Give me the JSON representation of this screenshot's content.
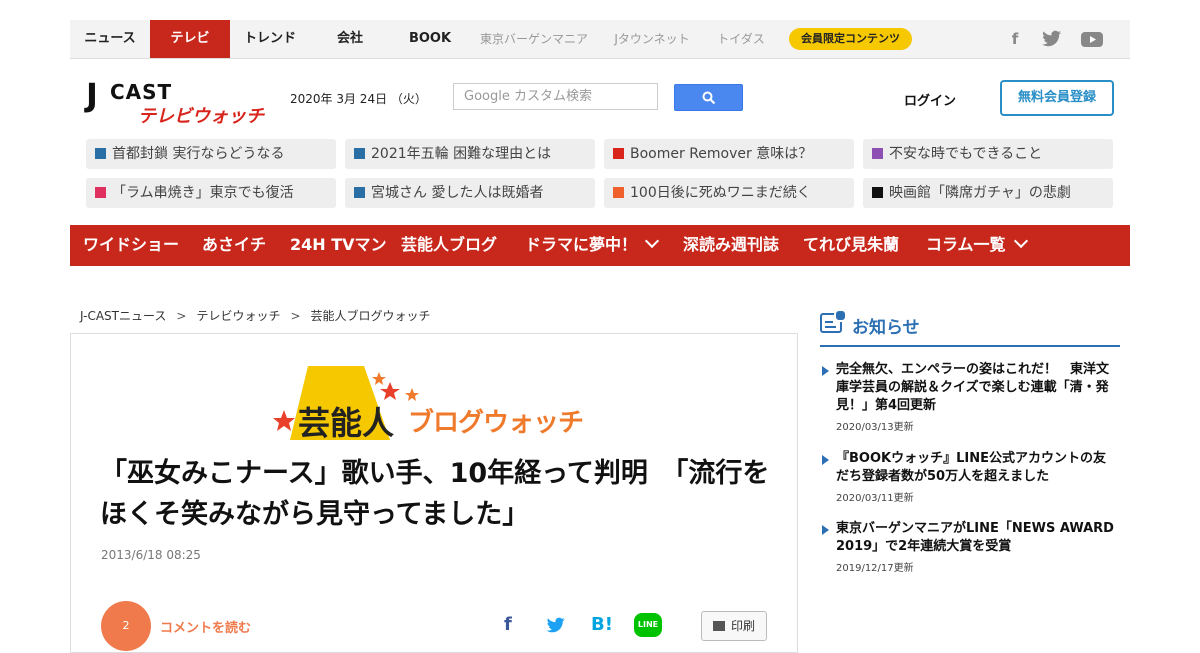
{
  "topnav": {
    "items": [
      "ニュース",
      "テレビ",
      "トレンド",
      "会社",
      "BOOK",
      "東京バーゲンマニア",
      "Jタウンネット",
      "トイダス"
    ],
    "members_badge": "会員限定コンテンツ",
    "social": [
      {
        "icon": "facebook-icon",
        "glyph": "f"
      },
      {
        "icon": "twitter-icon",
        "glyph": "🐦"
      },
      {
        "icon": "youtube-icon",
        "glyph": "▶"
      }
    ]
  },
  "header": {
    "logo_j": "J",
    "logo_cast": "CAST",
    "logo_sub": "テレビウォッチ",
    "date": "2020年 3月 24日 （火）",
    "search_placeholder": "Google カスタム検索",
    "login": "ログイン",
    "signup": "無料会員登録"
  },
  "trending": [
    {
      "text": "首都封鎖 実行ならどうなる",
      "color": "#2a6ea6"
    },
    {
      "text": "2021年五輪 困難な理由とは",
      "color": "#2a6ea6"
    },
    {
      "text": "Boomer Remover 意味は？",
      "color": "#d8241b"
    },
    {
      "text": "不安な時でもできること",
      "color": "#8e4fb2"
    },
    {
      "text": "「ラム串焼き」東京でも復活",
      "color": "#e0305f"
    },
    {
      "text": "宮城さん 愛した人は既婚者",
      "color": "#2a6ea6"
    },
    {
      "text": "100日後に死ぬワニまだ続く",
      "color": "#f0602c"
    },
    {
      "text": "映画館「隣席ガチャ」の悲劇",
      "color": "#111111"
    }
  ],
  "mainnav": [
    "ワイドショー",
    "あさイチ",
    "24H TVマン",
    "芸能人ブログ",
    "ドラマに夢中！",
    "深読み週刊誌",
    "てれび見朱蘭",
    "コラム一覧"
  ],
  "breadcrumb": [
    "J-CASTニュース",
    "テレビウォッチ",
    "芸能人ブログウォッチ"
  ],
  "article": {
    "banner_main": "芸能人",
    "banner_sub": "ブログウォッチ",
    "title": "「巫女みこナース」歌い手、10年経って判明　「流行をほくそ笑みながら見守ってました」",
    "timestamp": "2013/6/18 08:25",
    "comment_count": "2",
    "comment_link": "コメントを読む",
    "print": "印刷",
    "share": [
      {
        "icon": "facebook-share-icon",
        "glyph": "f",
        "color": "#3b5998"
      },
      {
        "icon": "twitter-share-icon",
        "glyph": "🐦",
        "color": "#1da1f2"
      },
      {
        "icon": "hatena-share-icon",
        "glyph": "B!",
        "color": "#00a4de"
      },
      {
        "icon": "line-share-icon",
        "glyph": "LINE",
        "color": "#00c300"
      }
    ]
  },
  "sidebar": {
    "notice_title": "お知らせ",
    "notices": [
      {
        "title": "完全無欠、エンペラーの姿はこれだ！　東洋文庫学芸員の解説＆クイズで楽しむ連載「清・発見！」第4回更新",
        "date": "2020/03/13更新"
      },
      {
        "title": "『BOOKウォッチ』LINE公式アカウントの友だち登録者数が50万人を超えました",
        "date": "2020/03/11更新"
      },
      {
        "title": "東京バーゲンマニアがLINE「NEWS AWARD 2019」で2年連続大賞を受賞",
        "date": "2019/12/17更新"
      }
    ]
  }
}
